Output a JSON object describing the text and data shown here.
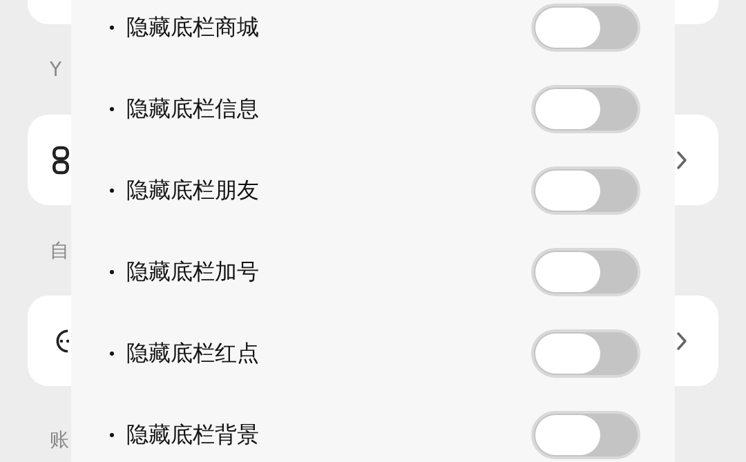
{
  "background_sections": [
    {
      "header": "Y",
      "kind": "grid"
    },
    {
      "header": "自",
      "kind": "face"
    },
    {
      "header": "账",
      "kind": "plain"
    }
  ],
  "panel": {
    "items": [
      {
        "label": "隐藏底栏商城",
        "on": false
      },
      {
        "label": "隐藏底栏信息",
        "on": false
      },
      {
        "label": "隐藏底栏朋友",
        "on": false
      },
      {
        "label": "隐藏底栏加号",
        "on": false
      },
      {
        "label": "隐藏底栏红点",
        "on": false
      },
      {
        "label": "隐藏底栏背景",
        "on": false
      }
    ]
  }
}
